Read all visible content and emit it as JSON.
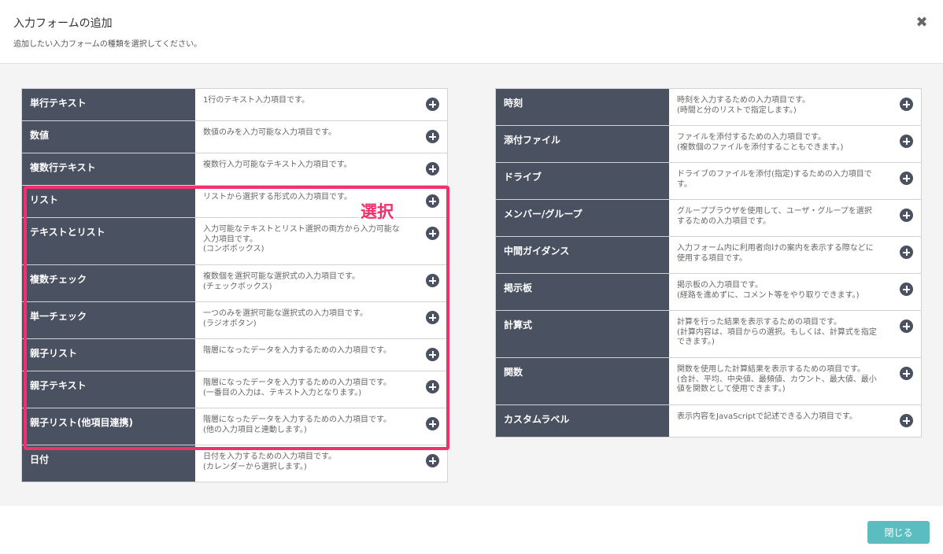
{
  "header": {
    "title": "入力フォームの追加",
    "subtitle": "追加したい入力フォームの種類を選択してください。",
    "close_symbol": "✖"
  },
  "left_items": [
    {
      "name": "単行テキスト",
      "desc": "1行のテキスト入力項目です。"
    },
    {
      "name": "数値",
      "desc": "数値のみを入力可能な入力項目です。"
    },
    {
      "name": "複数行テキスト",
      "desc": "複数行入力可能なテキスト入力項目です。"
    },
    {
      "name": "リスト",
      "desc": "リストから選択する形式の入力項目です。"
    },
    {
      "name": "テキストとリスト",
      "desc": "入力可能なテキストとリスト選択の両方から入力可能な\n入力項目です。\n(コンボボックス)"
    },
    {
      "name": "複数チェック",
      "desc": "複数個を選択可能な選択式の入力項目です。\n(チェックボックス)"
    },
    {
      "name": "単一チェック",
      "desc": "一つのみを選択可能な選択式の入力項目です。\n(ラジオボタン)"
    },
    {
      "name": "親子リスト",
      "desc": "階層になったデータを入力するための入力項目です。"
    },
    {
      "name": "親子テキスト",
      "desc": "階層になったデータを入力するための入力項目です。\n(一番目の入力は、テキスト入力となります。)"
    },
    {
      "name": "親子リスト(他項目連携)",
      "desc": "階層になったデータを入力するための入力項目です。\n(他の入力項目と連動します。)"
    },
    {
      "name": "日付",
      "desc": "日付を入力するための入力項目です。\n(カレンダーから選択します。)"
    }
  ],
  "right_items": [
    {
      "name": "時刻",
      "desc": "時刻を入力するための入力項目です。\n(時間と分のリストで指定します。)"
    },
    {
      "name": "添付ファイル",
      "desc": "ファイルを添付するための入力項目です。\n(複数個のファイルを添付することもできます。)"
    },
    {
      "name": "ドライブ",
      "desc": "ドライブのファイルを添付(指定)するための入力項目で\nす。"
    },
    {
      "name": "メンバー/グループ",
      "desc": "グループブラウザを使用して、ユーザ・グループを選択\nするための入力項目です。"
    },
    {
      "name": "中間ガイダンス",
      "desc": "入力フォーム内に利用者向けの案内を表示する際などに\n使用する項目です。"
    },
    {
      "name": "掲示板",
      "desc": "掲示板の入力項目です。\n(経路を進めずに、コメント等をやり取りできます。)"
    },
    {
      "name": "計算式",
      "desc": "計算を行った結果を表示するための項目です。\n(計算内容は、項目からの選択。もしくは、計算式を指定\nできます。)"
    },
    {
      "name": "関数",
      "desc": "関数を使用した計算結果を表示するための項目です。\n(合計、平均、中央値、最頻値、カウント、最大値、最小\n値を関数として使用できます。)"
    },
    {
      "name": "カスタムラベル",
      "desc": "表示内容をJavaScriptで記述できる入力項目です。"
    }
  ],
  "annotation": {
    "label": "選択",
    "color": "#f2316c"
  },
  "footer": {
    "close_label": "閉じる"
  },
  "colors": {
    "name_cell": "#4a5261",
    "close_button": "#5bbdbf"
  }
}
